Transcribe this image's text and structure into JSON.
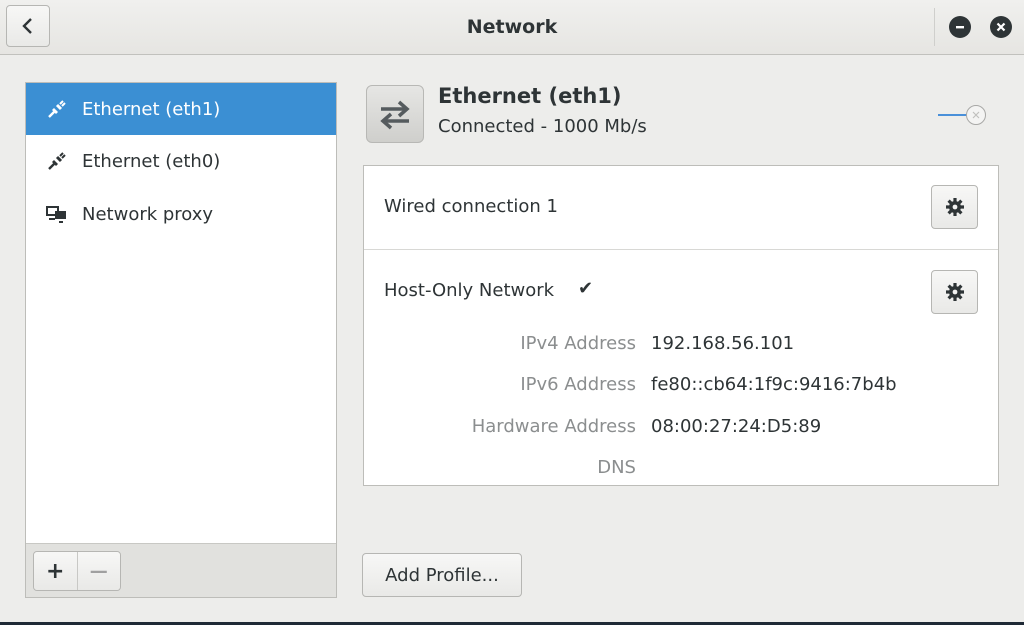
{
  "window": {
    "title": "Network"
  },
  "sidebar": {
    "items": [
      {
        "label": "Ethernet (eth1)",
        "icon": "ethernet-plug-icon",
        "selected": true
      },
      {
        "label": "Ethernet (eth0)",
        "icon": "ethernet-plug-icon",
        "selected": false
      },
      {
        "label": "Network proxy",
        "icon": "network-proxy-icon",
        "selected": false
      }
    ],
    "add_label": "+",
    "remove_label": "—"
  },
  "device": {
    "name": "Ethernet (eth1)",
    "status": "Connected - 1000 Mb/s",
    "icon": "network-transfer-arrows-icon",
    "switch_on": true
  },
  "connections": [
    {
      "name": "Wired connection 1",
      "active": false
    },
    {
      "name": "Host-Only Network",
      "active": true,
      "check_glyph": "✔"
    }
  ],
  "details": {
    "ipv4_label": "IPv4 Address",
    "ipv4_value": "192.168.56.101",
    "ipv6_label": "IPv6 Address",
    "ipv6_value": "fe80::cb64:1f9c:9416:7b4b",
    "hw_label": "Hardware Address",
    "hw_value": "08:00:27:24:D5:89",
    "dns_label": "DNS",
    "dns_value": ""
  },
  "actions": {
    "add_profile_label": "Add Profile..."
  },
  "colors": {
    "accent": "#3b8fd3",
    "background": "#ededeb"
  }
}
